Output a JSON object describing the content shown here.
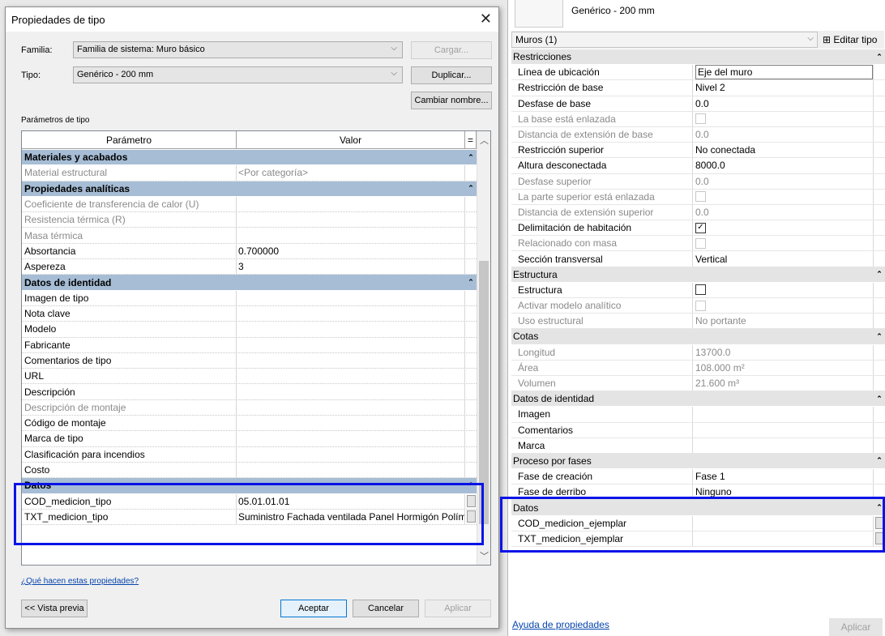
{
  "dialog": {
    "title": "Propiedades de tipo",
    "family_label": "Familia:",
    "family_value": "Familia de sistema: Muro básico",
    "type_label": "Tipo:",
    "type_value": "Genérico - 200 mm",
    "load_button": "Cargar...",
    "duplicate_button": "Duplicar...",
    "rename_button": "Cambiar nombre...",
    "section_label": "Parámetros de tipo",
    "col_param": "Parámetro",
    "col_value": "Valor",
    "col_eq": "=",
    "rows": [
      {
        "kind": "cat",
        "label": "Materiales y acabados"
      },
      {
        "kind": "grey",
        "label": "Material estructural",
        "value": "<Por categoría>"
      },
      {
        "kind": "cat",
        "label": "Propiedades analíticas"
      },
      {
        "kind": "grey",
        "label": "Coeficiente de transferencia de calor (U)",
        "value": ""
      },
      {
        "kind": "grey",
        "label": "Resistencia térmica (R)",
        "value": ""
      },
      {
        "kind": "grey",
        "label": "Masa térmica",
        "value": ""
      },
      {
        "kind": "normal",
        "label": "Absortancia",
        "value": "0.700000"
      },
      {
        "kind": "normal",
        "label": "Aspereza",
        "value": "3"
      },
      {
        "kind": "cat",
        "label": "Datos de identidad"
      },
      {
        "kind": "normal",
        "label": "Imagen de tipo",
        "value": ""
      },
      {
        "kind": "normal",
        "label": "Nota clave",
        "value": ""
      },
      {
        "kind": "normal",
        "label": "Modelo",
        "value": ""
      },
      {
        "kind": "normal",
        "label": "Fabricante",
        "value": ""
      },
      {
        "kind": "normal",
        "label": "Comentarios de tipo",
        "value": ""
      },
      {
        "kind": "normal",
        "label": "URL",
        "value": ""
      },
      {
        "kind": "normal",
        "label": "Descripción",
        "value": ""
      },
      {
        "kind": "grey",
        "label": "Descripción de montaje",
        "value": ""
      },
      {
        "kind": "normal",
        "label": "Código de montaje",
        "value": ""
      },
      {
        "kind": "normal",
        "label": "Marca de tipo",
        "value": ""
      },
      {
        "kind": "normal",
        "label": "Clasificación para incendios",
        "value": ""
      },
      {
        "kind": "normal",
        "label": "Costo",
        "value": ""
      },
      {
        "kind": "cat",
        "label": "Datos"
      },
      {
        "kind": "normal",
        "label": "COD_medicion_tipo",
        "value": "05.01.01.01",
        "btn": true
      },
      {
        "kind": "normal",
        "label": "TXT_medicion_tipo",
        "value": "Suministro Fachada ventilada Panel Hormigón Polím",
        "btn": true
      }
    ],
    "help_link": "¿Qué hacen estas propiedades?",
    "preview_button": "<< Vista previa",
    "ok_button": "Aceptar",
    "cancel_button": "Cancelar",
    "apply_button": "Aplicar"
  },
  "palette": {
    "type_name": "Genérico - 200 mm",
    "selector": "Muros (1)",
    "edit_type": "Editar tipo",
    "rows": [
      {
        "kind": "cat",
        "label": "Restricciones"
      },
      {
        "kind": "normal",
        "label": "Línea de ubicación",
        "value": "Eje del muro",
        "input": true
      },
      {
        "kind": "normal",
        "label": "Restricción de base",
        "value": "Nivel 2"
      },
      {
        "kind": "normal",
        "label": "Desfase de base",
        "value": "0.0"
      },
      {
        "kind": "grey",
        "label": "La base está enlazada",
        "check": "off"
      },
      {
        "kind": "grey",
        "label": "Distancia de extensión de base",
        "value": "0.0"
      },
      {
        "kind": "normal",
        "label": "Restricción superior",
        "value": "No conectada"
      },
      {
        "kind": "normal",
        "label": "Altura desconectada",
        "value": "8000.0"
      },
      {
        "kind": "grey",
        "label": "Desfase superior",
        "value": "0.0"
      },
      {
        "kind": "grey",
        "label": "La parte superior está enlazada",
        "check": "off"
      },
      {
        "kind": "grey",
        "label": "Distancia de extensión superior",
        "value": "0.0"
      },
      {
        "kind": "normal",
        "label": "Delimitación de habitación",
        "check": "on"
      },
      {
        "kind": "grey",
        "label": "Relacionado con masa",
        "check": "off"
      },
      {
        "kind": "normal",
        "label": "Sección transversal",
        "value": "Vertical"
      },
      {
        "kind": "cat",
        "label": "Estructura"
      },
      {
        "kind": "normal",
        "label": "Estructura",
        "check": "off"
      },
      {
        "kind": "grey",
        "label": "Activar modelo analítico",
        "check": "off"
      },
      {
        "kind": "grey",
        "label": "Uso estructural",
        "value": "No portante"
      },
      {
        "kind": "cat",
        "label": "Cotas"
      },
      {
        "kind": "grey",
        "label": "Longitud",
        "value": "13700.0"
      },
      {
        "kind": "grey",
        "label": "Área",
        "value": "108.000 m²"
      },
      {
        "kind": "grey",
        "label": "Volumen",
        "value": "21.600 m³"
      },
      {
        "kind": "cat",
        "label": "Datos de identidad"
      },
      {
        "kind": "normal",
        "label": "Imagen",
        "value": ""
      },
      {
        "kind": "normal",
        "label": "Comentarios",
        "value": ""
      },
      {
        "kind": "normal",
        "label": "Marca",
        "value": ""
      },
      {
        "kind": "cat",
        "label": "Proceso por fases"
      },
      {
        "kind": "normal",
        "label": "Fase de creación",
        "value": "Fase 1"
      },
      {
        "kind": "normal",
        "label": "Fase de derribo",
        "value": "Ninguno"
      },
      {
        "kind": "cat",
        "label": "Datos"
      },
      {
        "kind": "normal",
        "label": "COD_medicion_ejemplar",
        "value": "",
        "btn": true
      },
      {
        "kind": "normal",
        "label": "TXT_medicion_ejemplar",
        "value": "",
        "btn": true
      }
    ],
    "help_link": "Ayuda de propiedades",
    "apply_button": "Aplicar"
  },
  "colors": {
    "category_bg": "#a6bdd5",
    "highlight": "#0a14e6",
    "palette_category_bg": "#e4e4e4",
    "link": "#0645ad"
  }
}
